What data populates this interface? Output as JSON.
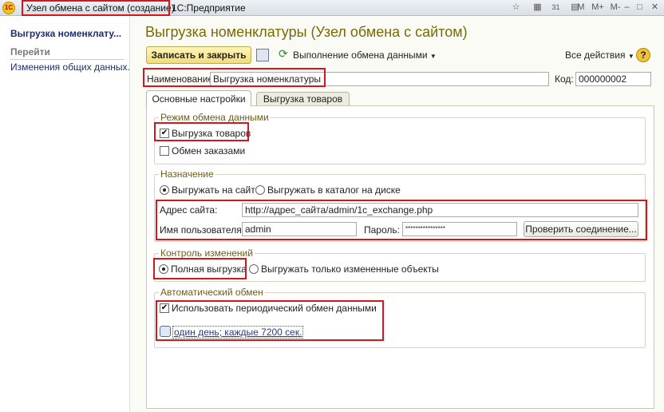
{
  "window": {
    "logo": "1С",
    "title_main": "Узел обмена с сайтом (создание)",
    "title_app": "1С:Предприятие",
    "controls": [
      "M",
      "M+",
      "M-"
    ]
  },
  "sidebar": {
    "items": [
      {
        "label": "Выгрузка номенклату..."
      },
      {
        "label": "Перейти"
      },
      {
        "label": "Изменения общих данных..."
      }
    ]
  },
  "page": {
    "title": "Выгрузка номенклатуры (Узел обмена с сайтом)"
  },
  "toolbar": {
    "save_close": "Записать и закрыть",
    "exchange": "Выполнение обмена данными",
    "all_actions": "Все действия",
    "help": "?"
  },
  "form": {
    "name_label": "Наименование:",
    "name_value": "Выгрузка номенклатуры",
    "code_label": "Код:",
    "code_value": "000000002"
  },
  "tabs": [
    {
      "label": "Основные настройки",
      "active": true
    },
    {
      "label": "Выгрузка товаров",
      "active": false
    }
  ],
  "mode_group": {
    "title": "Режим обмена данными",
    "goods_upload": {
      "label": "Выгрузка товаров",
      "checked": true
    },
    "orders_exchange": {
      "label": "Обмен заказами",
      "checked": false
    }
  },
  "destination": {
    "title": "Назначение",
    "to_site": {
      "label": "Выгружать на сайт",
      "selected": true
    },
    "to_disk": {
      "label": "Выгружать в каталог на диске",
      "selected": false
    },
    "site_label": "Адрес сайта:",
    "site_value": "http://адрес_сайта/admin/1c_exchange.php",
    "user_label": "Имя пользователя:",
    "user_value": "admin",
    "password_label": "Пароль:",
    "password_value": "****************",
    "check_button": "Проверить соединение..."
  },
  "changes_control": {
    "title": "Контроль изменений",
    "full": {
      "label": "Полная выгрузка",
      "selected": true
    },
    "changed_only": {
      "label": "Выгружать только измененные объекты",
      "selected": false
    }
  },
  "auto_exchange": {
    "title": "Автоматический обмен",
    "periodic": {
      "label": "Использовать периодический обмен данными",
      "checked": true
    },
    "schedule_link": "один день; каждые 7200 сек."
  },
  "colors": {
    "highlight": "#d5161d",
    "accent_title": "#7a6a00",
    "button_yellow": "#f1dc7a"
  }
}
